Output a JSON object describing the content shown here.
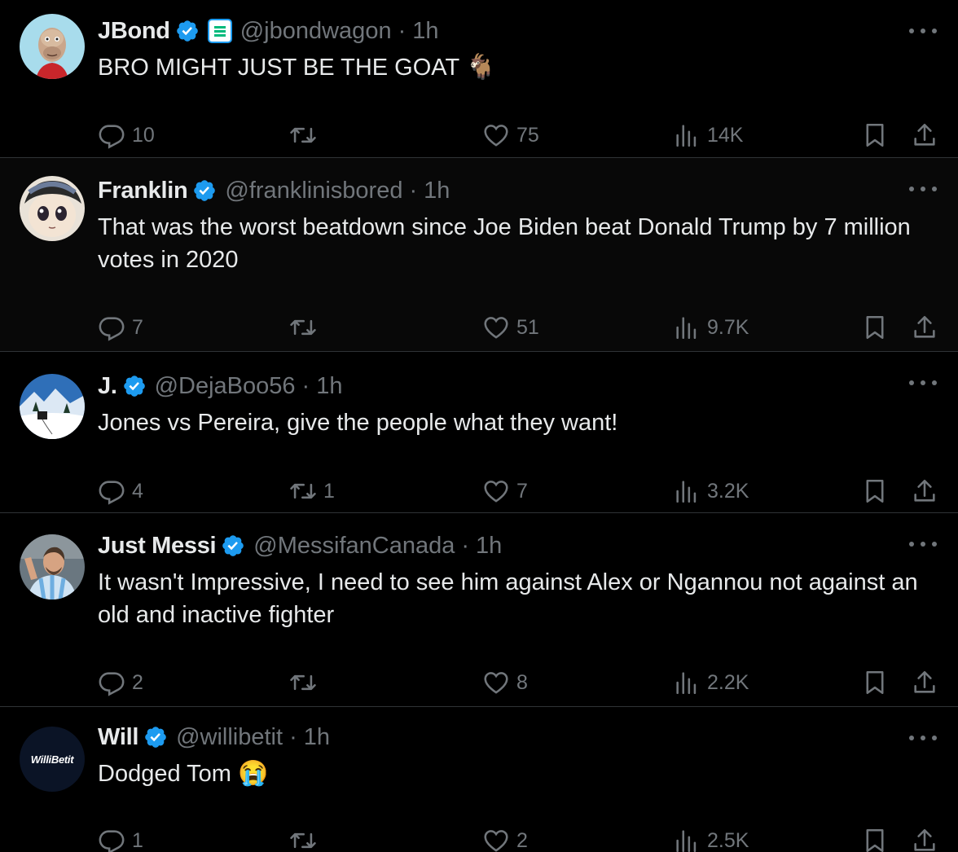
{
  "tweets": [
    {
      "name": "JBond",
      "handle": "@jbondwagon",
      "time": "1h",
      "text": "BRO MIGHT JUST BE THE GOAT",
      "emoji": "🐐",
      "replies": "10",
      "retweets": "",
      "likes": "75",
      "views": "14K",
      "avatar": "ape-avatar"
    },
    {
      "name": "Franklin",
      "handle": "@franklinisbored",
      "time": "1h",
      "text": "That was the worst beatdown since Joe Biden beat Donald Trump by 7 million votes in 2020",
      "replies": "7",
      "retweets": "",
      "likes": "51",
      "views": "9.7K",
      "avatar": "anime-avatar"
    },
    {
      "name": "J.",
      "handle": "@DejaBoo56",
      "time": "1h",
      "text": "Jones vs Pereira, give the people what they want!",
      "replies": "4",
      "retweets": "1",
      "likes": "7",
      "views": "3.2K",
      "avatar": "snow-mountain-avatar"
    },
    {
      "name": "Just Messi",
      "handle": "@MessifanCanada",
      "time": "1h",
      "text": "It wasn't Impressive, I need to see him against Alex or Ngannou not against an old and inactive fighter",
      "replies": "2",
      "retweets": "",
      "likes": "8",
      "views": "2.2K",
      "avatar": "messi-avatar"
    },
    {
      "name": "Will",
      "handle": "@willibetit",
      "time": "1h",
      "text": "Dodged Tom",
      "emoji": "😭",
      "replies": "1",
      "retweets": "",
      "likes": "2",
      "views": "2.5K",
      "avatar": "willibetit-logo-avatar",
      "avatar_text": "WilliBetit"
    }
  ],
  "dot_separator": "·",
  "colors": {
    "background": "#000000",
    "text": "#e7e9ea",
    "secondary": "#71767b",
    "verified": "#1d9bf0",
    "divider": "#2f3336"
  }
}
